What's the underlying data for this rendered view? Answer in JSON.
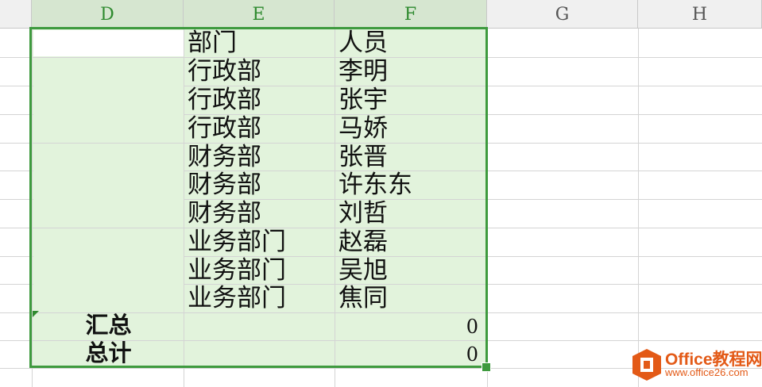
{
  "columns": {
    "d": "D",
    "e": "E",
    "f": "F",
    "g": "G",
    "h": "H"
  },
  "rows": [
    {
      "dept": "部门",
      "person": "人员"
    },
    {
      "dept": "行政部",
      "person": "李明"
    },
    {
      "dept": "行政部",
      "person": "张宇"
    },
    {
      "dept": "行政部",
      "person": "马娇"
    },
    {
      "dept": "财务部",
      "person": "张晋"
    },
    {
      "dept": "财务部",
      "person": "许东东"
    },
    {
      "dept": "财务部",
      "person": "刘哲"
    },
    {
      "dept": "业务部门",
      "person": "赵磊"
    },
    {
      "dept": "业务部门",
      "person": "吴旭"
    },
    {
      "dept": "业务部门",
      "person": "焦同"
    }
  ],
  "summary": {
    "subtotal_label": "汇总",
    "subtotal_value": "0",
    "total_label": "总计",
    "total_value": "0"
  },
  "colors": {
    "selection_border": "#3e9a3e",
    "selection_fill": "#e2f3dc",
    "header_selected": "#d6e6d0",
    "logo": "#e35a17"
  },
  "watermark": {
    "brand": "Office教程网",
    "url": "www.office26.com"
  }
}
